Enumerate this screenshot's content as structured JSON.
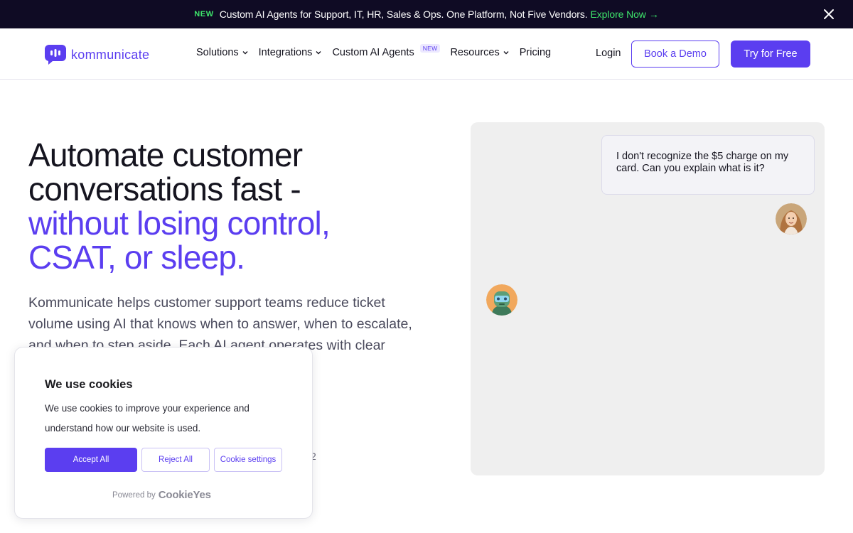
{
  "announcement": {
    "tag": "NEW",
    "message": "Custom AI Agents for Support, IT, HR, Sales & Ops. One Platform, Not Five Vendors.",
    "cta_label": "Explore Now",
    "cta_arrow": "→",
    "close_icon": "close-icon"
  },
  "header": {
    "logo_text": "kommunicate",
    "nav": [
      {
        "label": "Solutions",
        "has_dropdown": true
      },
      {
        "label": "Integrations",
        "has_dropdown": true
      },
      {
        "label": "Custom AI Agents",
        "badge": "NEW"
      },
      {
        "label": "Resources",
        "has_dropdown": true
      },
      {
        "label": "Pricing"
      }
    ],
    "login_label": "Login",
    "demo_label": "Book a Demo",
    "free_label": "Try for Free"
  },
  "hero": {
    "title_line1": "Automate customer",
    "title_line2": "conversations fast -",
    "title_accent_line1": "without losing control,",
    "title_accent_line2": "CSAT, or sleep.",
    "description": "Kommunicate helps customer support teams reduce ticket volume using AI that knows when to answer, when to escalate, and when to step aside. Each AI agent operates with clear",
    "partial_text": "2"
  },
  "chat": {
    "user_message": "I don't recognize the $5 charge on my card. Can you explain what is it?",
    "user_avatar_icon": "user-avatar-icon",
    "bot_avatar_icon": "bot-avatar-icon"
  },
  "cookie_banner": {
    "title": "We use cookies",
    "text": "We use cookies to improve your experience and understand how our website is used.",
    "accept_label": "Accept All",
    "reject_label": "Reject All",
    "settings_label": "Cookie settings",
    "powered_by": "Powered by",
    "brand": "CookieYes"
  },
  "colors": {
    "brand": "#5b3ef0",
    "announcement_bg": "#0f0b24",
    "announcement_accent": "#3ee56b"
  }
}
